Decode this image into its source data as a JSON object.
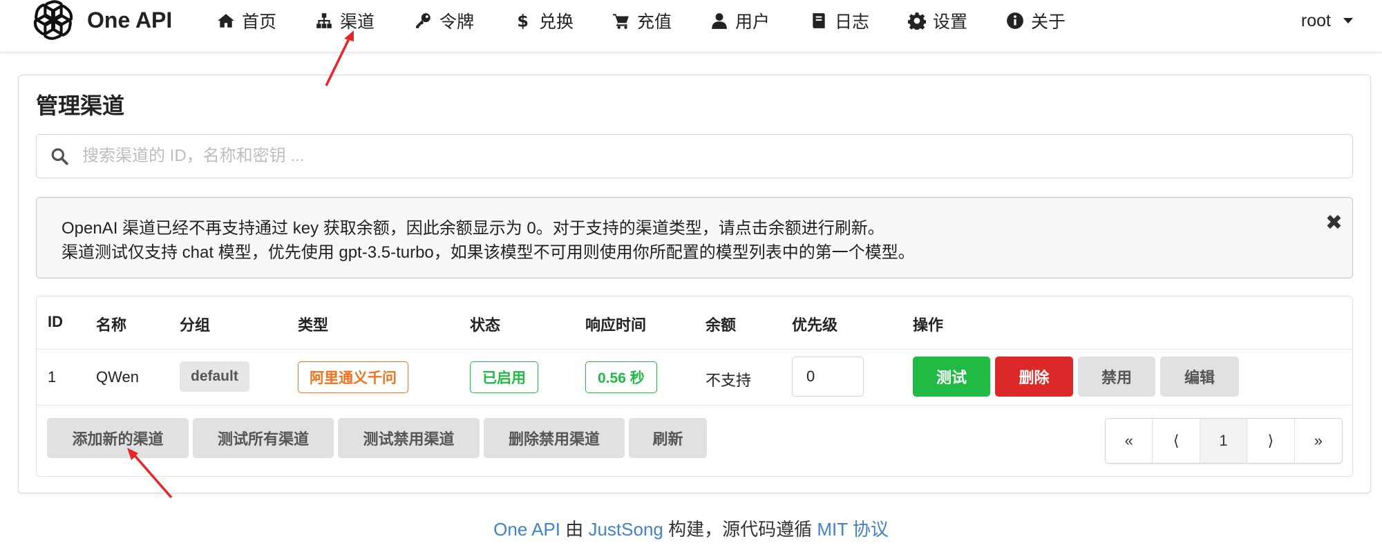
{
  "brand": {
    "name": "One API"
  },
  "nav": {
    "items": [
      {
        "label": "首页",
        "icon": "home-icon"
      },
      {
        "label": "渠道",
        "icon": "sitemap-icon"
      },
      {
        "label": "令牌",
        "icon": "key-icon"
      },
      {
        "label": "兑换",
        "icon": "dollar-icon"
      },
      {
        "label": "充值",
        "icon": "cart-icon"
      },
      {
        "label": "用户",
        "icon": "user-icon"
      },
      {
        "label": "日志",
        "icon": "book-icon"
      },
      {
        "label": "设置",
        "icon": "gear-icon"
      },
      {
        "label": "关于",
        "icon": "info-icon"
      }
    ],
    "user": "root"
  },
  "page": {
    "title": "管理渠道",
    "search_placeholder": "搜索渠道的 ID，名称和密钥 ...",
    "notice": {
      "line1": "OpenAI 渠道已经不再支持通过 key 获取余额，因此余额显示为 0。对于支持的渠道类型，请点击余额进行刷新。",
      "line2": "渠道测试仅支持 chat 模型，优先使用 gpt-3.5-turbo，如果该模型不可用则使用你所配置的模型列表中的第一个模型。",
      "close": "✖"
    }
  },
  "table": {
    "headers": [
      "ID",
      "名称",
      "分组",
      "类型",
      "状态",
      "响应时间",
      "余额",
      "优先级",
      "操作"
    ],
    "rows": [
      {
        "id": "1",
        "name": "QWen",
        "group": "default",
        "type": "阿里通义千问",
        "status": "已启用",
        "response_time": "0.56 秒",
        "balance": "不支持",
        "priority": "0",
        "actions": [
          "测试",
          "删除",
          "禁用",
          "编辑"
        ]
      }
    ],
    "footer_buttons": [
      "添加新的渠道",
      "测试所有渠道",
      "测试禁用渠道",
      "删除禁用渠道",
      "刷新"
    ],
    "pagination": [
      "«",
      "⟨",
      "1",
      "⟩",
      "»"
    ]
  },
  "footer": {
    "link1": "One API",
    "text1": " 由 ",
    "link2": "JustSong",
    "text2": " 构建，源代码遵循 ",
    "link3": "MIT 协议"
  },
  "colors": {
    "primary_green": "#21ba45",
    "danger_red": "#db2828",
    "warning_orange": "#f2711c",
    "link_blue": "#4183c4",
    "annotation_arrow": "#e8262a"
  }
}
